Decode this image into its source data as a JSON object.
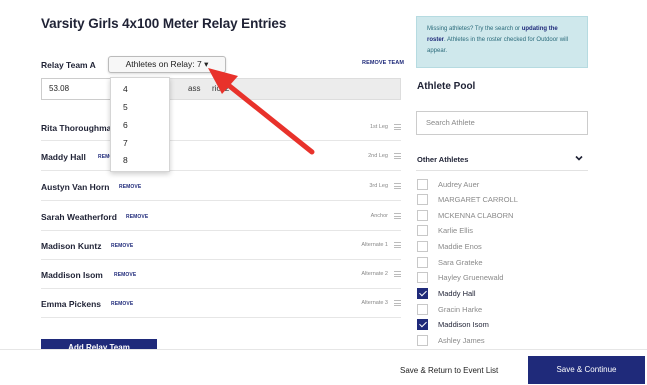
{
  "page": {
    "title": "Varsity Girls 4x100 Meter Relay Entries"
  },
  "team": {
    "label": "Relay Team A",
    "athletes_button": "Athletes on Relay: 7 ▾",
    "remove_team": "REMOVE TEAM",
    "time_value": "53.08",
    "class_visible_fragment_1": "ass",
    "class_visible_fragment_2": "rict 2"
  },
  "dropdown": {
    "options": [
      "4",
      "5",
      "6",
      "7",
      "8"
    ]
  },
  "entries": [
    {
      "name": "Rita Thoroughmar",
      "remove": "",
      "leg": "1st Leg"
    },
    {
      "name": "Maddy Hall",
      "remove": "REMOVE",
      "leg": "2nd Leg"
    },
    {
      "name": "Austyn Van Horn",
      "remove": "REMOVE",
      "leg": "3rd Leg"
    },
    {
      "name": "Sarah Weatherford",
      "remove": "REMOVE",
      "leg": "Anchor"
    },
    {
      "name": "Madison Kuntz",
      "remove": "REMOVE",
      "leg": "Alternate 1"
    },
    {
      "name": "Maddison Isom",
      "remove": "REMOVE",
      "leg": "Alternate 2"
    },
    {
      "name": "Emma Pickens",
      "remove": "REMOVE",
      "leg": "Alternate 3"
    }
  ],
  "add_team_button": "Add Relay Team",
  "sidebar": {
    "info_text_1": "Missing athletes? Try the search or ",
    "info_link": "updating the roster",
    "info_text_2": ". Athletes in the roster checked for Outdoor will appear.",
    "pool_title": "Athlete Pool",
    "search_placeholder": "Search Athlete",
    "other_label": "Other Athletes",
    "athletes": [
      {
        "name": "Audrey Auer",
        "checked": false
      },
      {
        "name": "MARGARET CARROLL",
        "checked": false
      },
      {
        "name": "MCKENNA CLABORN",
        "checked": false
      },
      {
        "name": "Karlie Ellis",
        "checked": false
      },
      {
        "name": "Maddie Enos",
        "checked": false
      },
      {
        "name": "Sara Grateke",
        "checked": false
      },
      {
        "name": "Hayley Gruenewald",
        "checked": false
      },
      {
        "name": "Maddy Hall",
        "checked": true
      },
      {
        "name": "Gracin Harke",
        "checked": false
      },
      {
        "name": "Maddison Isom",
        "checked": true
      },
      {
        "name": "Ashley James",
        "checked": false
      }
    ]
  },
  "footer": {
    "save_return": "Save & Return to Event List",
    "save_continue": "Save & Continue"
  },
  "colors": {
    "navy": "#1f2a7a",
    "info_bg": "#cfe8ec",
    "arrow": "#e8322b"
  }
}
